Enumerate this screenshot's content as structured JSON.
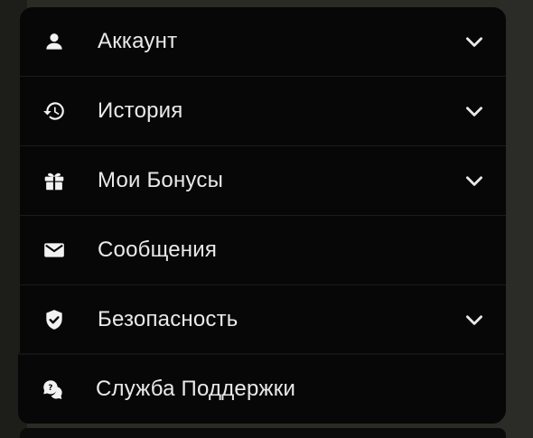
{
  "colors": {
    "background": "#2a2b25",
    "card": "#070707",
    "text": "#e9e9e9",
    "icon": "#f2f2f2",
    "chevron": "#e9e9e9"
  },
  "menu": {
    "items": [
      {
        "label": "Аккаунт",
        "icon": "user-icon",
        "expandable": true
      },
      {
        "label": "История",
        "icon": "history-icon",
        "expandable": true
      },
      {
        "label": "Мои Бонусы",
        "icon": "gift-icon",
        "expandable": true
      },
      {
        "label": "Сообщения",
        "icon": "mail-icon",
        "expandable": false
      },
      {
        "label": "Безопасность",
        "icon": "shield-check-icon",
        "expandable": true
      },
      {
        "label": "Служба Поддержки",
        "icon": "chat-support-icon",
        "expandable": false
      }
    ]
  }
}
